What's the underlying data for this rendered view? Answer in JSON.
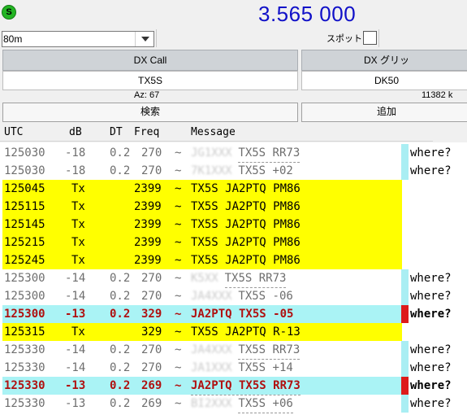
{
  "header": {
    "status_letter": "S",
    "frequency": "3.565 000"
  },
  "band": {
    "selected": "80m"
  },
  "spot": {
    "label": "スポット"
  },
  "dx_call": {
    "header": "DX Call",
    "value": "TX5S"
  },
  "dx_grid": {
    "header": "DX グリッ",
    "value": "DK50"
  },
  "az": "Az: 67",
  "distance": "11382 k",
  "buttons": {
    "lookup": "検索",
    "add": "追加"
  },
  "log": {
    "columns": [
      "UTC",
      "dB",
      "DT",
      "Freq",
      "Message"
    ],
    "rows": [
      {
        "utc": "125030",
        "db": "-18",
        "dt": "0.2",
        "freq": "270",
        "sep": "~",
        "pre": "JG1XXX",
        "msg": "TX5S RR73",
        "where": "where?"
      },
      {
        "utc": "125030",
        "db": "-18",
        "dt": "0.2",
        "freq": "270",
        "sep": "~",
        "pre": "7K1XXX",
        "msg": "TX5S +02",
        "where": "where?"
      },
      {
        "utc": "125045",
        "db": "Tx",
        "dt": "",
        "freq": "2399",
        "sep": "~",
        "pre": "",
        "msg": "TX5S JA2PTQ PM86",
        "where": ""
      },
      {
        "utc": "125115",
        "db": "Tx",
        "dt": "",
        "freq": "2399",
        "sep": "~",
        "pre": "",
        "msg": "TX5S JA2PTQ PM86",
        "where": ""
      },
      {
        "utc": "125145",
        "db": "Tx",
        "dt": "",
        "freq": "2399",
        "sep": "~",
        "pre": "",
        "msg": "TX5S JA2PTQ PM86",
        "where": ""
      },
      {
        "utc": "125215",
        "db": "Tx",
        "dt": "",
        "freq": "2399",
        "sep": "~",
        "pre": "",
        "msg": "TX5S JA2PTQ PM86",
        "where": ""
      },
      {
        "utc": "125245",
        "db": "Tx",
        "dt": "",
        "freq": "2399",
        "sep": "~",
        "pre": "",
        "msg": "TX5S JA2PTQ PM86",
        "where": ""
      },
      {
        "utc": "125300",
        "db": "-14",
        "dt": "0.2",
        "freq": "270",
        "sep": "~",
        "pre": "K5XX",
        "msg": "TX5S RR73",
        "where": "where?"
      },
      {
        "utc": "125300",
        "db": "-14",
        "dt": "0.2",
        "freq": "270",
        "sep": "~",
        "pre": "JA4XXX",
        "msg": "TX5S -06",
        "where": "where?"
      },
      {
        "utc": "125300",
        "db": "-13",
        "dt": "0.2",
        "freq": "329",
        "sep": "~",
        "pre": "",
        "msg": "JA2PTQ TX5S -05",
        "where": "where?"
      },
      {
        "utc": "125315",
        "db": "Tx",
        "dt": "",
        "freq": "329",
        "sep": "~",
        "pre": "",
        "msg": "TX5S JA2PTQ R-13",
        "where": ""
      },
      {
        "utc": "125330",
        "db": "-14",
        "dt": "0.2",
        "freq": "270",
        "sep": "~",
        "pre": "JA4XXX",
        "msg": "TX5S RR73",
        "where": "where?"
      },
      {
        "utc": "125330",
        "db": "-14",
        "dt": "0.2",
        "freq": "270",
        "sep": "~",
        "pre": "JA1XXX",
        "msg": "TX5S +14",
        "where": "where?"
      },
      {
        "utc": "125330",
        "db": "-13",
        "dt": "0.2",
        "freq": "269",
        "sep": "~",
        "pre": "",
        "msg": "JA2PTQ TX5S RR73",
        "where": "where?"
      },
      {
        "utc": "125330",
        "db": "-13",
        "dt": "0.2",
        "freq": "269",
        "sep": "~",
        "pre": "BI2XXX",
        "msg": "TX5S +06",
        "where": "where?"
      }
    ]
  },
  "colors": {
    "tx_fill": "#ffff00",
    "call_fill": "#aaf3f5",
    "cyan_bar": "#a9eef3",
    "red_bar": "#dd1a1a",
    "freq_blue": "#1010c8"
  }
}
